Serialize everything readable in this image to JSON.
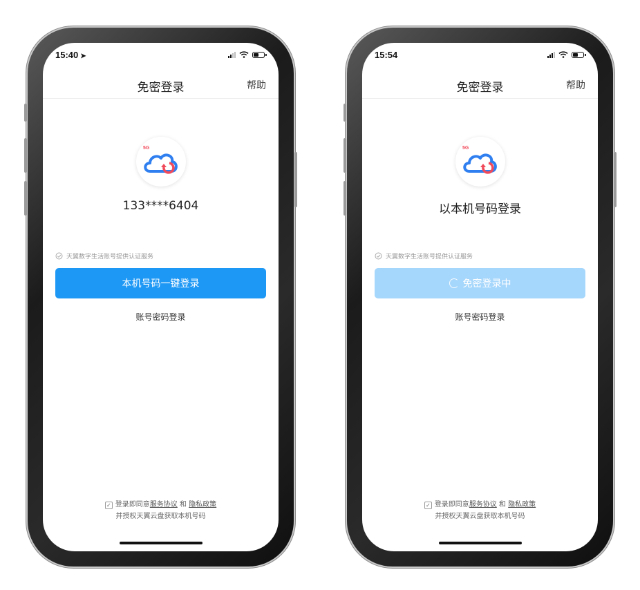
{
  "screens": [
    {
      "status_time": "15:40",
      "show_location_arrow": true,
      "nav_title": "免密登录",
      "help_label": "帮助",
      "logo_badge": "5G",
      "main_text": "133****6404",
      "provider_text": "天翼数字生活账号提供认证服务",
      "primary_button_label": "本机号码一键登录",
      "primary_loading": false,
      "alt_login_label": "账号密码登录",
      "agree_prefix": "登录即同意",
      "service_agreement": "服务协议",
      "and_text": "和",
      "privacy_policy": "隐私政策",
      "authorize_text": "并授权天翼云盘获取本机号码",
      "checkbox_mark": "✓"
    },
    {
      "status_time": "15:54",
      "show_location_arrow": false,
      "nav_title": "免密登录",
      "help_label": "帮助",
      "logo_badge": "5G",
      "main_text": "以本机号码登录",
      "provider_text": "天翼数字生活账号提供认证服务",
      "primary_button_label": "免密登录中",
      "primary_loading": true,
      "alt_login_label": "账号密码登录",
      "agree_prefix": "登录即同意",
      "service_agreement": "服务协议",
      "and_text": "和",
      "privacy_policy": "隐私政策",
      "authorize_text": "并授权天翼云盘获取本机号码",
      "checkbox_mark": "✓"
    }
  ],
  "colors": {
    "primary": "#1e98f5",
    "primary_loading": "#a5d6fb",
    "logo_blue": "#2f7ff0",
    "logo_red": "#f04a5a"
  }
}
